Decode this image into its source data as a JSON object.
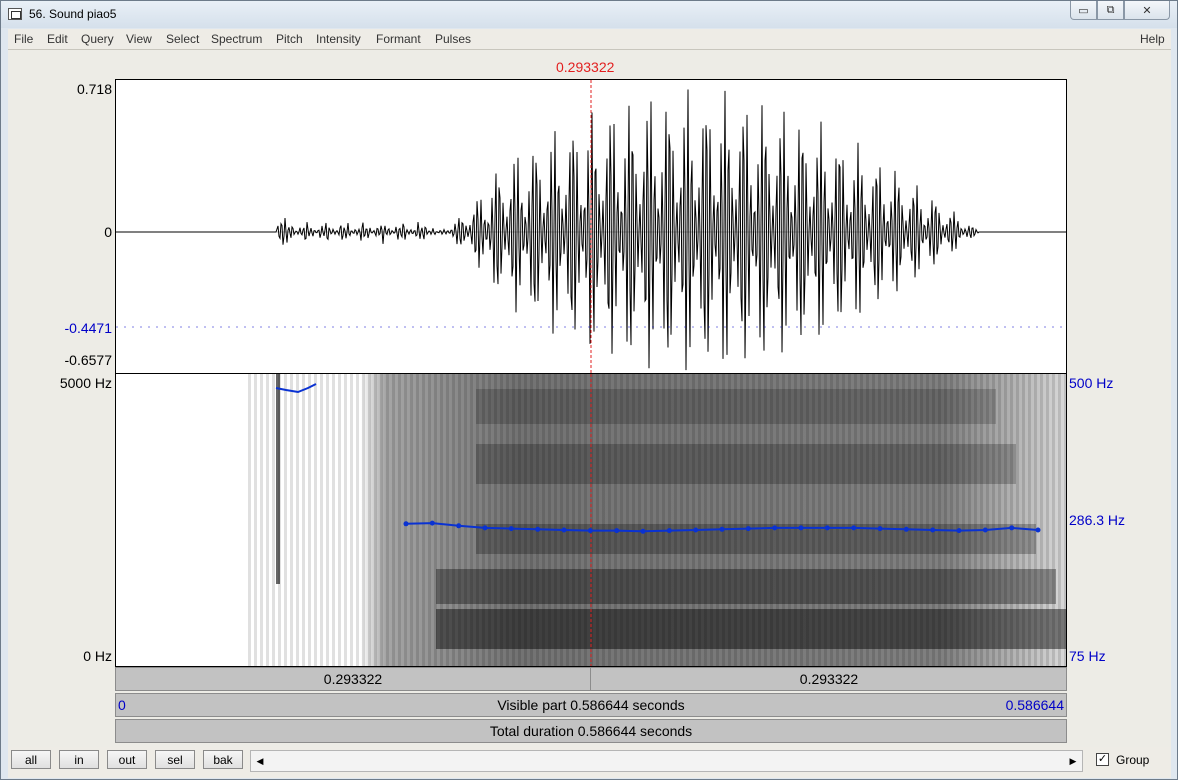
{
  "window": {
    "title": "56. Sound piao5"
  },
  "controls": {
    "minimize": "▭",
    "restore": "⧉",
    "close": "✕"
  },
  "menu": [
    "File",
    "Edit",
    "Query",
    "View",
    "Select",
    "Spectrum",
    "Pitch",
    "Intensity",
    "Formant",
    "Pulses"
  ],
  "help": "Help",
  "cursor_time": "0.293322",
  "waveform": {
    "y_max": "0.718",
    "y_zero": "0",
    "y_cursor_value": "-0.4471",
    "y_min": "-0.6577"
  },
  "spectrogram": {
    "freq_max": "5000 Hz",
    "freq_min": "0 Hz",
    "pitch_max": "500 Hz",
    "pitch_cursor": "286.3 Hz",
    "pitch_min": "75 Hz"
  },
  "time_bars": {
    "left_segment": "0.293322",
    "right_segment": "0.293322",
    "visible_start": "0",
    "visible_label": "Visible part 0.586644 seconds",
    "visible_end": "0.586644",
    "total_label": "Total duration 0.586644 seconds"
  },
  "buttons": {
    "all": "all",
    "in": "in",
    "out": "out",
    "sel": "sel",
    "bak": "bak"
  },
  "group": {
    "label": "Group",
    "checked": "✓"
  },
  "colors": {
    "cursor": "#e21f1f",
    "pitch": "#0a32d2",
    "axis_blue": "#0000c8"
  },
  "pitch_track_hz": [
    282,
    283,
    279,
    276,
    275,
    274,
    273,
    272,
    272,
    271,
    272,
    273,
    274,
    275,
    276,
    276,
    276,
    276,
    275,
    274,
    273,
    272,
    273,
    276,
    273
  ]
}
